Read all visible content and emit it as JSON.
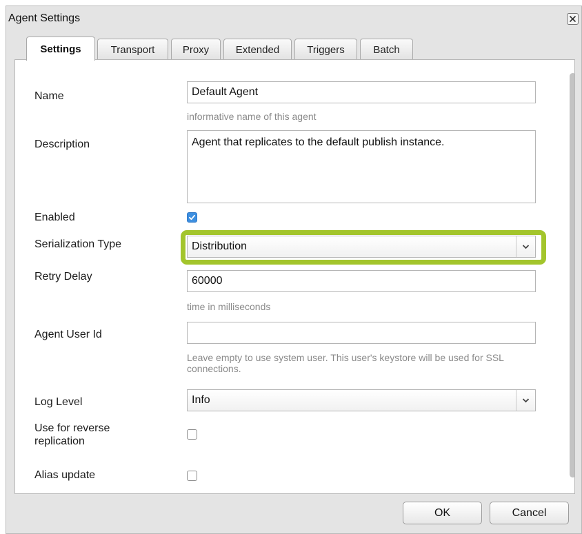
{
  "dialog": {
    "title": "Agent Settings",
    "close_icon": "close-icon"
  },
  "tabs": [
    {
      "label": "Settings",
      "active": true
    },
    {
      "label": "Transport",
      "active": false
    },
    {
      "label": "Proxy",
      "active": false
    },
    {
      "label": "Extended",
      "active": false
    },
    {
      "label": "Triggers",
      "active": false
    },
    {
      "label": "Batch",
      "active": false
    }
  ],
  "form": {
    "name": {
      "label": "Name",
      "value": "Default Agent",
      "hint": "informative name of this agent"
    },
    "description": {
      "label": "Description",
      "value": "Agent that replicates to the default publish instance."
    },
    "enabled": {
      "label": "Enabled",
      "checked": true
    },
    "serialization_type": {
      "label": "Serialization Type",
      "value": "Distribution"
    },
    "retry_delay": {
      "label": "Retry Delay",
      "value": "60000",
      "hint": "time in milliseconds"
    },
    "agent_user_id": {
      "label": "Agent User Id",
      "value": "",
      "hint": "Leave empty to use system user. This user's keystore will be used for SSL connections."
    },
    "log_level": {
      "label": "Log Level",
      "value": "Info"
    },
    "reverse_replication": {
      "label": "Use for reverse replication",
      "checked": false
    },
    "alias_update": {
      "label": "Alias update",
      "checked": false
    }
  },
  "highlight_color": "#a3c52c",
  "buttons": {
    "ok": "OK",
    "cancel": "Cancel"
  }
}
